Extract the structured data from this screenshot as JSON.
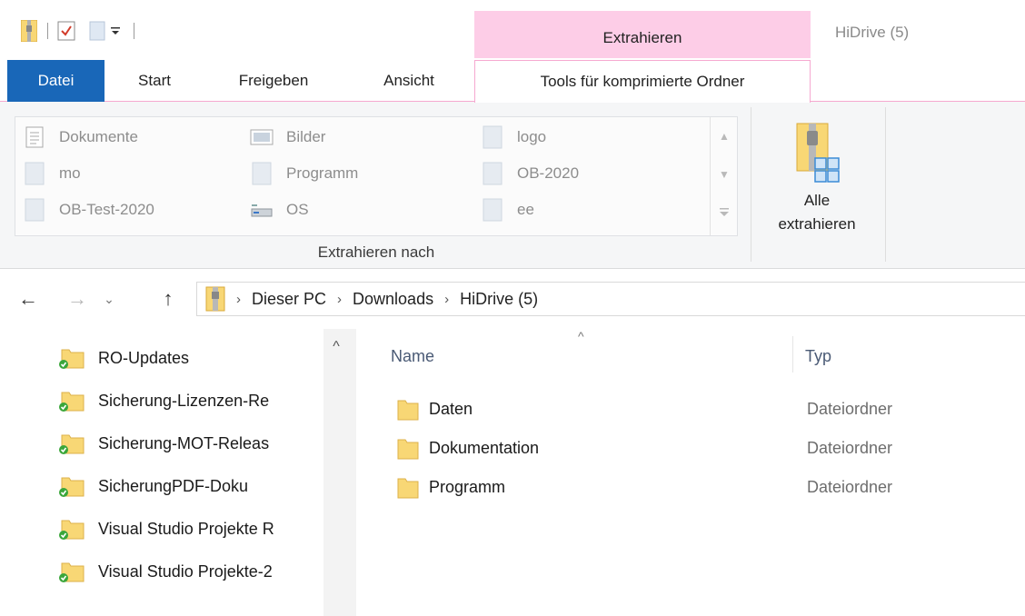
{
  "window": {
    "title": "HiDrive (5)",
    "context_tab_header": "Extrahieren"
  },
  "quick_access": {
    "icons": [
      "zip-folder-icon",
      "properties-checkmark-icon",
      "new-folder-icon",
      "customize-dropdown-icon"
    ]
  },
  "ribbon": {
    "tabs": [
      "Datei",
      "Start",
      "Freigeben",
      "Ansicht",
      "Tools für komprimierte Ordner"
    ],
    "active_tab": "Tools für komprimierte Ordner",
    "extract_to": {
      "items": [
        "Dokumente",
        "Bilder",
        "logo",
        "mo",
        "Programm",
        "OB-2020",
        "OB-Test-2020",
        "OS",
        "ee"
      ],
      "group_label": "Extrahieren nach"
    },
    "extract_all": {
      "line1": "Alle",
      "line2": "extrahieren"
    }
  },
  "address_bar": {
    "crumbs": [
      "Dieser PC",
      "Downloads",
      "HiDrive (5)"
    ]
  },
  "nav_pane": {
    "items": [
      "RO-Updates",
      "Sicherung-Lizenzen-Re",
      "Sicherung-MOT-Releas",
      "SicherungPDF-Doku",
      "Visual Studio Projekte R",
      "Visual Studio Projekte-2"
    ]
  },
  "file_list": {
    "columns": {
      "name": "Name",
      "type": "Typ"
    },
    "sort_indicator": "^",
    "rows": [
      {
        "name": "Daten",
        "type": "Dateiordner"
      },
      {
        "name": "Dokumentation",
        "type": "Dateiordner"
      },
      {
        "name": "Programm",
        "type": "Dateiordner"
      }
    ]
  },
  "colors": {
    "file_tab": "#1967b8",
    "context_tab": "#fdcde7",
    "folder": "#f8d775",
    "sync_check": "#3aa63a"
  }
}
